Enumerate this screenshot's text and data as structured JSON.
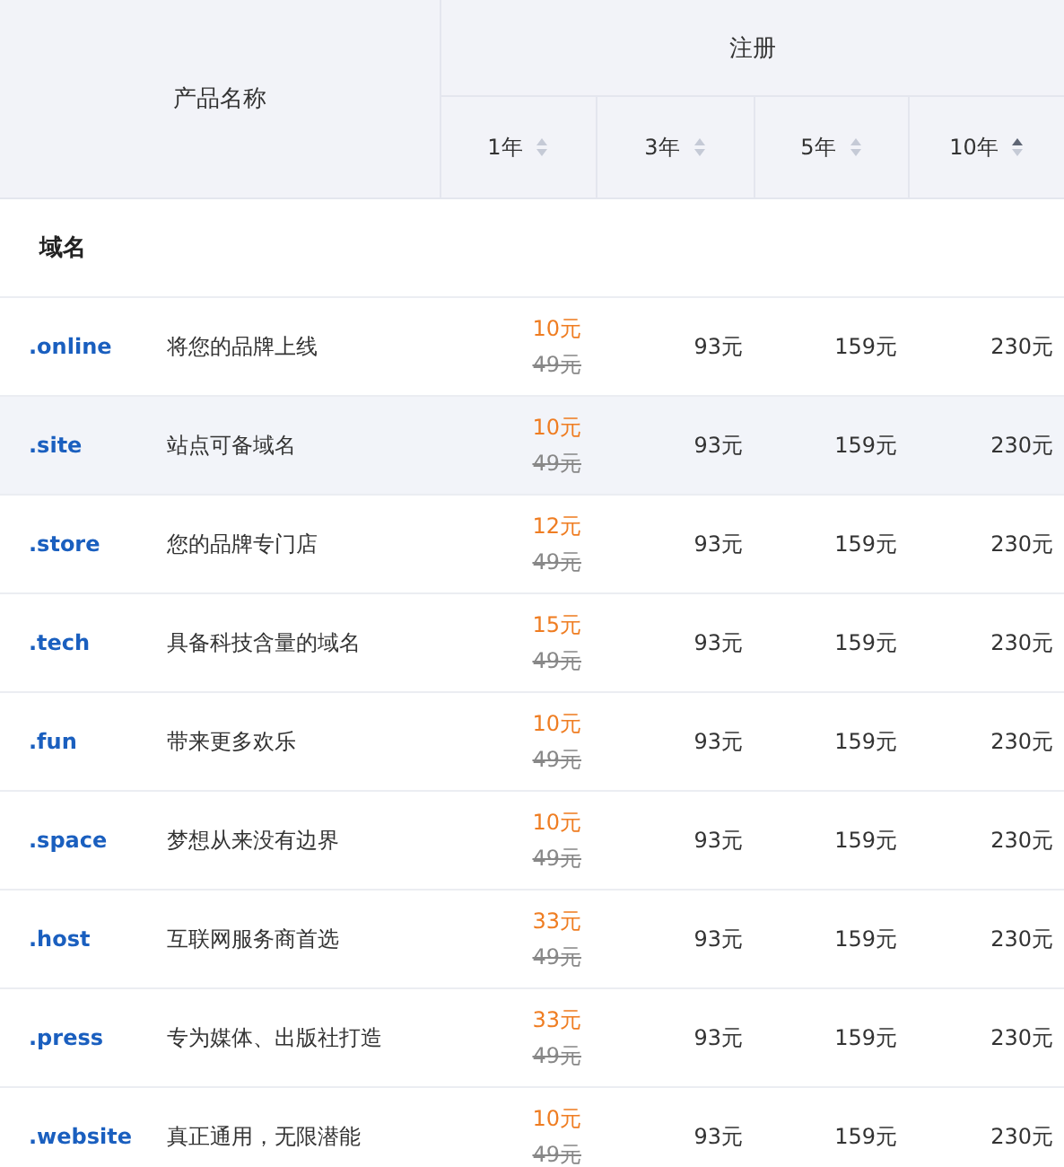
{
  "header": {
    "product_column": "产品名称",
    "group": "注册",
    "periods": [
      {
        "label": "1年",
        "sorted_ascending": false
      },
      {
        "label": "3年",
        "sorted_ascending": false
      },
      {
        "label": "5年",
        "sorted_ascending": false
      },
      {
        "label": "10年",
        "sorted_ascending": true
      }
    ]
  },
  "section": "域名",
  "rows": [
    {
      "domain": ".online",
      "description": "将您的品牌上线",
      "sale_price": "10元",
      "original_price": "49元",
      "prices": [
        "93元",
        "159元",
        "230元"
      ],
      "selected": false
    },
    {
      "domain": ".site",
      "description": "站点可备域名",
      "sale_price": "10元",
      "original_price": "49元",
      "prices": [
        "93元",
        "159元",
        "230元"
      ],
      "selected": true
    },
    {
      "domain": ".store",
      "description": "您的品牌专门店",
      "sale_price": "12元",
      "original_price": "49元",
      "prices": [
        "93元",
        "159元",
        "230元"
      ],
      "selected": false
    },
    {
      "domain": ".tech",
      "description": "具备科技含量的域名",
      "sale_price": "15元",
      "original_price": "49元",
      "prices": [
        "93元",
        "159元",
        "230元"
      ],
      "selected": false
    },
    {
      "domain": ".fun",
      "description": "带来更多欢乐",
      "sale_price": "10元",
      "original_price": "49元",
      "prices": [
        "93元",
        "159元",
        "230元"
      ],
      "selected": false
    },
    {
      "domain": ".space",
      "description": "梦想从来没有边界",
      "sale_price": "10元",
      "original_price": "49元",
      "prices": [
        "93元",
        "159元",
        "230元"
      ],
      "selected": false
    },
    {
      "domain": ".host",
      "description": "互联网服务商首选",
      "sale_price": "33元",
      "original_price": "49元",
      "prices": [
        "93元",
        "159元",
        "230元"
      ],
      "selected": false
    },
    {
      "domain": ".press",
      "description": "专为媒体、出版社打造",
      "sale_price": "33元",
      "original_price": "49元",
      "prices": [
        "93元",
        "159元",
        "230元"
      ],
      "selected": false
    },
    {
      "domain": ".website",
      "description": "真正通用，无限潜能",
      "sale_price": "10元",
      "original_price": "49元",
      "prices": [
        "93元",
        "159元",
        "230元"
      ],
      "selected": false
    }
  ]
}
